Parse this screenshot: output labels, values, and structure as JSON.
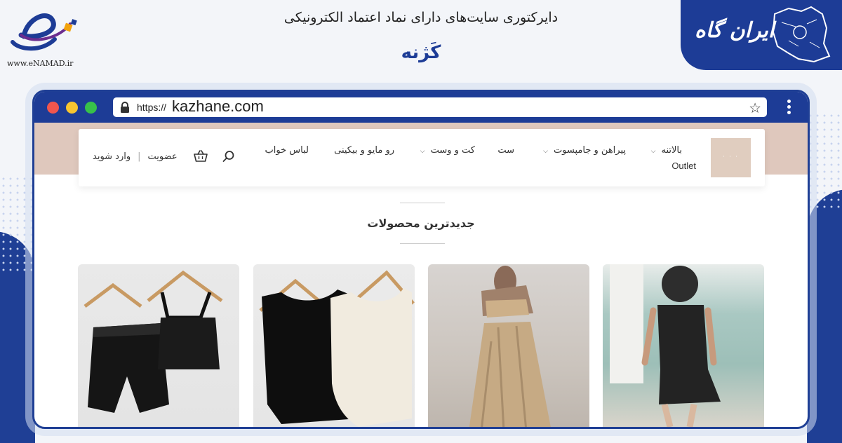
{
  "banner": {
    "directory_title": "دایرکتوری سایت‌های دارای نماد اعتماد الکترونیکی",
    "site_name": "کَژنه",
    "enamad_url": "www.eNAMAD.ir",
    "irangah_logo_text": "ایران گاه"
  },
  "browser": {
    "url_protocol": "https://",
    "url_domain": "kazhane.com"
  },
  "nav": {
    "items": [
      {
        "label": "بالاتنه",
        "has_dropdown": true
      },
      {
        "label": "پیراهن و جامپسوت",
        "has_dropdown": true
      },
      {
        "label": "ست",
        "has_dropdown": false
      },
      {
        "label": "کت و وست",
        "has_dropdown": true
      },
      {
        "label": "رو مایو و بیکینی",
        "has_dropdown": false
      },
      {
        "label": "لباس خواب",
        "has_dropdown": false
      }
    ],
    "outlet": "Outlet",
    "signup": "عضویت",
    "login": "وارد شوید",
    "icons": [
      "search-icon",
      "basket-icon"
    ]
  },
  "section": {
    "title": "جدیدترین محصولات"
  },
  "colors": {
    "brand_blue": "#1d3c96",
    "hero_band": "#dfc8bd"
  }
}
